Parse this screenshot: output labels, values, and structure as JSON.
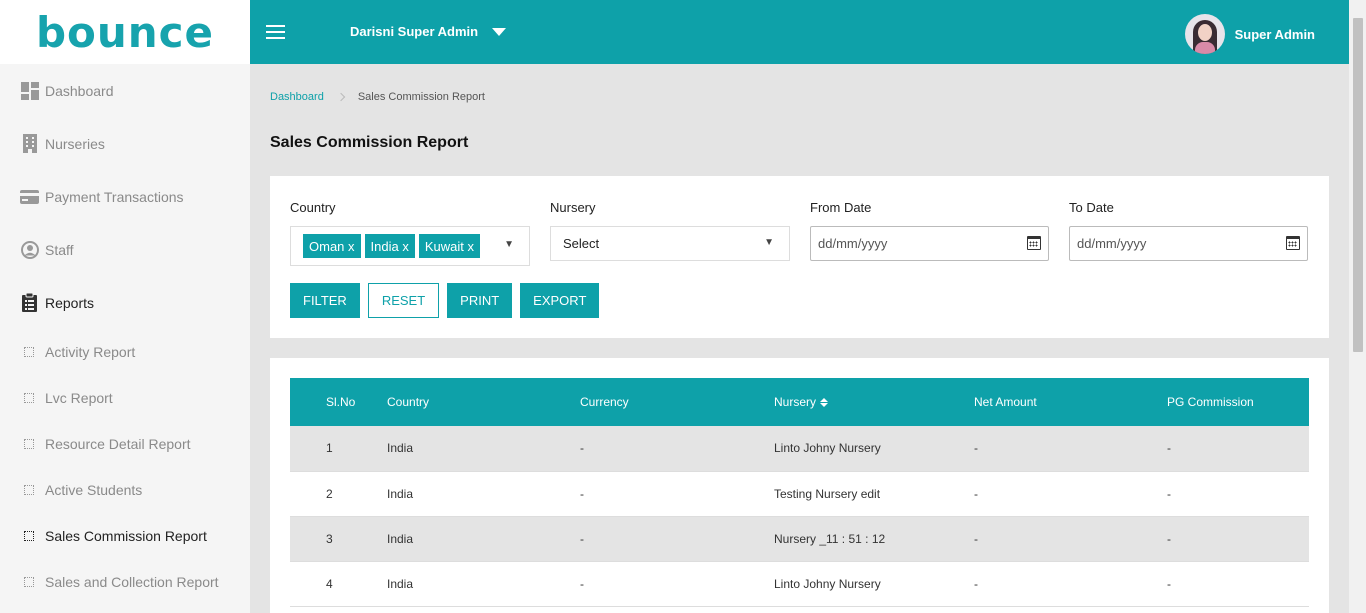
{
  "brand": {
    "logo_text": "bounce",
    "colors": {
      "primary": "#0ea1a9",
      "logo_accent": "#9bc93b"
    }
  },
  "sidebar": {
    "items": [
      {
        "label": "Dashboard",
        "icon": "dashboard-icon"
      },
      {
        "label": "Nurseries",
        "icon": "building-icon"
      },
      {
        "label": "Payment Transactions",
        "icon": "credit-card-icon"
      },
      {
        "label": "Staff",
        "icon": "user-circle-icon"
      },
      {
        "label": "Reports",
        "icon": "clipboard-icon"
      }
    ],
    "sub_items": [
      {
        "label": "Activity Report"
      },
      {
        "label": "Lvc Report"
      },
      {
        "label": "Resource Detail Report"
      },
      {
        "label": "Active Students"
      },
      {
        "label": "Sales Commission Report"
      },
      {
        "label": "Sales and Collection Report"
      }
    ]
  },
  "topbar": {
    "role": "Darisni Super Admin",
    "user_name": "Super Admin"
  },
  "breadcrumb": {
    "home": "Dashboard",
    "current": "Sales Commission Report"
  },
  "page_title": "Sales Commission Report",
  "filters": {
    "country_label": "Country",
    "countries_selected": [
      "Oman x",
      "India x",
      "Kuwait x"
    ],
    "nursery_label": "Nursery",
    "nursery_value": "Select",
    "from_label": "From Date",
    "from_placeholder": "dd/mm/yyyy",
    "to_label": "To Date",
    "to_placeholder": "dd/mm/yyyy"
  },
  "buttons": {
    "filter": "FILTER",
    "reset": "RESET",
    "print": "PRINT",
    "export": "EXPORT"
  },
  "table": {
    "headers": [
      "Sl.No",
      "Country",
      "Currency",
      "Nursery",
      "Net Amount",
      "PG Commission"
    ],
    "rows": [
      [
        "1",
        "India",
        "-",
        "Linto Johny Nursery",
        "-",
        "-"
      ],
      [
        "2",
        "India",
        "-",
        "Testing Nursery edit",
        "-",
        "-"
      ],
      [
        "3",
        "India",
        "-",
        "Nursery _11 : 51 : 12",
        "-",
        "-"
      ],
      [
        "4",
        "India",
        "-",
        "Linto Johny Nursery",
        "-",
        "-"
      ]
    ]
  }
}
